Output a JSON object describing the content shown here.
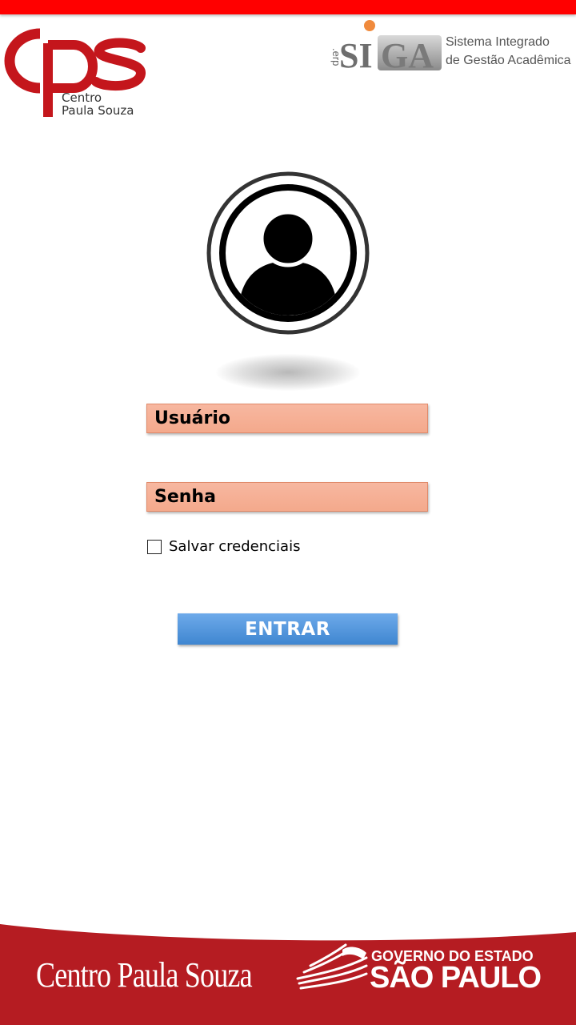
{
  "header": {
    "cps_logo": {
      "mark": "cps",
      "line1": "Centro",
      "line2": "Paula Souza"
    },
    "siga_logo": {
      "prefix": ".erp",
      "mark": "SIGA",
      "line1": "Sistema Integrado",
      "line2": "de Gestão Acadêmica"
    }
  },
  "avatar": {
    "icon": "user-avatar-icon"
  },
  "login": {
    "username_placeholder": "Usuário",
    "username_value": "",
    "password_placeholder": "Senha",
    "password_value": "",
    "save_credentials_label": "Salvar credenciais",
    "save_credentials_checked": false,
    "submit_label": "ENTRAR"
  },
  "footer": {
    "cps_text": "Centro Paula Souza",
    "gov_line1": "GOVERNO DO ESTADO",
    "gov_line2": "SÃO PAULO"
  },
  "colors": {
    "top_bar": "#ff0000",
    "brand_red": "#c4161c",
    "field_fill": "#f4a98c",
    "button_blue": "#4a90d9",
    "footer_red": "#b51c22"
  }
}
